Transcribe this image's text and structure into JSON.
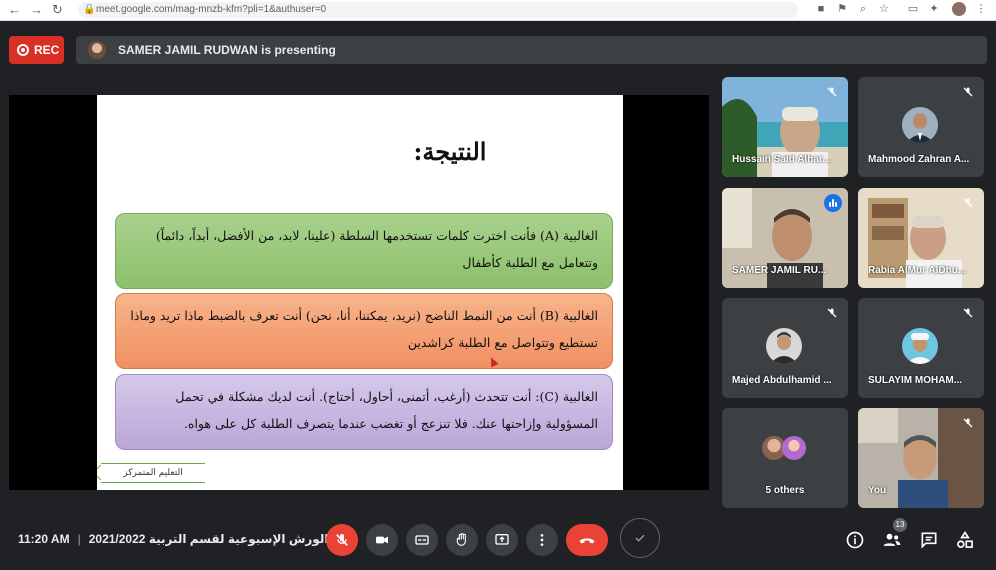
{
  "browser": {
    "url": "meet.google.com/mag-mnzb-kfm?pli=1&authuser=0"
  },
  "header": {
    "rec_label": "REC",
    "presenting_text": "SAMER JAMIL RUDWAN is presenting"
  },
  "slide": {
    "title": "النتيجة:",
    "box_a": "الغالبية (A) فأنت اخترت كلمات تستخدمها السلطة (علينا، لابد، من الأفضل، أبداً، دائماً) وتتعامل مع الطلبة كأطفال",
    "box_b": "الغالبية (B) أنت من النمط الناضج (نريد، يمكننا، أنا، نحن) أنت تعرف بالضبط ماذا تريد وماذا تستطيع وتتواصل مع الطلبة كراشدين",
    "box_c": "الغالبية (C): أنت تتحدث (أرغب، أتمنى، أحاول، أحتاج). أنت لديك مشكلة في تحمل المسؤولية وإزاحتها عنك. فلا تنزعج أو تغضب عندما يتصرف الطلبة كل على هواه.",
    "footer_tag": "التعليم المتمركز"
  },
  "participants": [
    {
      "name": "Hussain Said Alhar..."
    },
    {
      "name": "Mahmood Zahran A..."
    },
    {
      "name": "SAMER JAMIL RU..."
    },
    {
      "name": "Rabia AlMur AlDhu..."
    },
    {
      "name": "Majed Abdulhamid ..."
    },
    {
      "name": "SULAYIM MOHAM..."
    },
    {
      "name": "5 others"
    },
    {
      "name": "You"
    }
  ],
  "bottom": {
    "time": "11:20 AM",
    "separator": "|",
    "meeting_title": "الورش الإسبوعية لقسم التربية 2021/2022",
    "participant_count": "13"
  },
  "colors": {
    "background": "#202124",
    "tile": "#3c4043",
    "rec_red": "#d93025",
    "end_call": "#ea4335",
    "active_outline": "#8ab4f8"
  }
}
